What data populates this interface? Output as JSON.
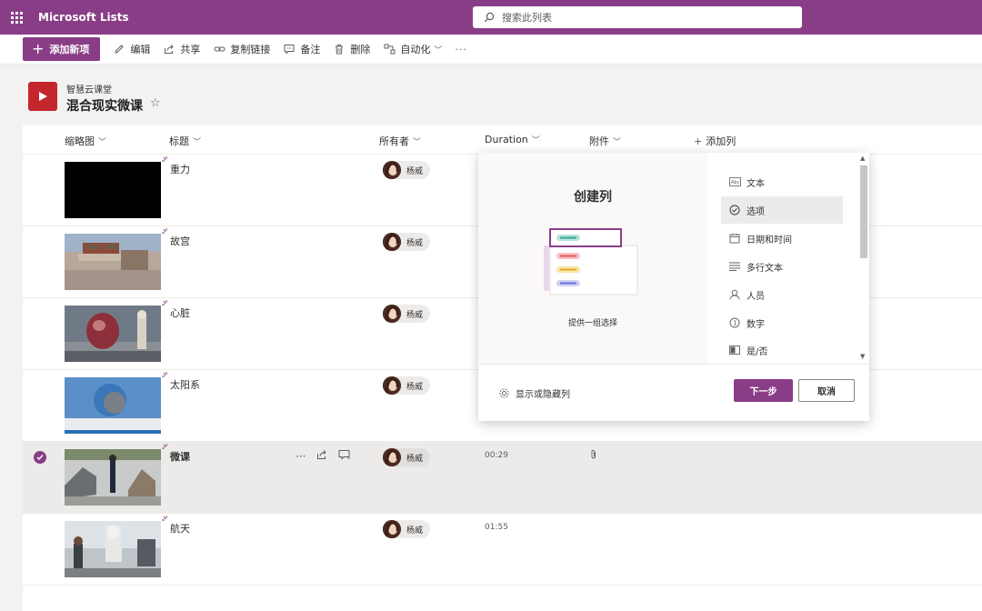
{
  "app": {
    "title": "Microsoft Lists",
    "waffle_icon": "waffle-icon"
  },
  "search": {
    "placeholder": "搜索此列表"
  },
  "commands": {
    "new_item": "添加新项",
    "edit": "编辑",
    "share": "共享",
    "copy_link": "复制链接",
    "comment": "备注",
    "delete": "删除",
    "automate": "自动化",
    "more": "···"
  },
  "list": {
    "site": "智慧云课堂",
    "title": "混合现实微课",
    "favorite_icon": "star-icon"
  },
  "columns": {
    "thumbnail": "缩略图",
    "title": "标题",
    "owner": "所有者",
    "duration": "Duration",
    "attachments": "附件",
    "add_column": "添加列"
  },
  "rows": [
    {
      "title": "重力",
      "owner": "杨威",
      "duration": "",
      "selected": false
    },
    {
      "title": "故宫",
      "owner": "杨威",
      "duration": "",
      "selected": false
    },
    {
      "title": "心脏",
      "owner": "杨威",
      "duration": "",
      "selected": false
    },
    {
      "title": "太阳系",
      "owner": "杨威",
      "duration": "",
      "selected": false
    },
    {
      "title": "微课",
      "owner": "杨威",
      "duration": "00:29",
      "selected": true,
      "has_attachment": true
    },
    {
      "title": "航天",
      "owner": "杨威",
      "duration": "01:55",
      "selected": false
    }
  ],
  "row_actions": {
    "more": "···"
  },
  "create_column": {
    "heading": "创建列",
    "description": "提供一组选择",
    "types": [
      "文本",
      "选项",
      "日期和时间",
      "多行文本",
      "人员",
      "数字",
      "是/否"
    ],
    "selected_type": "选项",
    "show_hide": "显示或隐藏列",
    "next": "下一步",
    "cancel": "取消"
  },
  "colors": {
    "brand": "#8a3d87",
    "delete_red": "#c4262e"
  }
}
